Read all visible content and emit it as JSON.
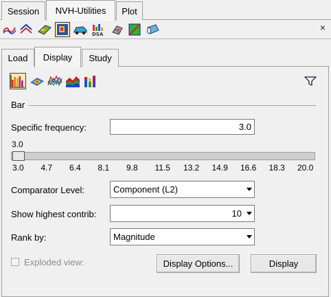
{
  "top_tabs": [
    {
      "label": "Session",
      "active": false
    },
    {
      "label": "NVH-Utilities",
      "active": true
    },
    {
      "label": "Plot",
      "active": false
    }
  ],
  "toolbar": {
    "tools": [
      "curve-plot-icon",
      "response-curves-icon",
      "model-contour-icon",
      "contributions-icon",
      "vehicle-icon",
      "dsa-icon",
      "transfer-path-icon",
      "modal-icon",
      "cylinder-icon"
    ],
    "selected": "contributions-icon",
    "close_label": "×"
  },
  "sub_tabs": [
    {
      "label": "Load",
      "active": false
    },
    {
      "label": "Display",
      "active": true
    },
    {
      "label": "Study",
      "active": false
    }
  ],
  "chart_types": [
    "bar-chart-icon",
    "contour-chart-icon",
    "line-chart-icon",
    "area-chart-icon",
    "stacked-bar-icon"
  ],
  "chart_type_selected": "bar-chart-icon",
  "filter_icon": "filter-icon",
  "section": {
    "title": "Bar"
  },
  "frequency": {
    "label": "Specific frequency:",
    "value": "3.0",
    "slider_value_label": "3.0",
    "slider_fraction": 0.0,
    "ticks": [
      "3.0",
      "4.7",
      "6.4",
      "8.1",
      "9.8",
      "11.5",
      "13.2",
      "14.9",
      "16.6",
      "18.3",
      "20.0"
    ]
  },
  "comparator": {
    "label": "Comparator Level:",
    "value": "Component (L2)"
  },
  "highest": {
    "label": "Show highest contrib:",
    "value": "10"
  },
  "rank": {
    "label": "Rank by:",
    "value": "Magnitude"
  },
  "exploded": {
    "label": "Exploded view:",
    "checked": false,
    "enabled": false
  },
  "buttons": {
    "display_options": "Display Options...",
    "display": "Display"
  }
}
